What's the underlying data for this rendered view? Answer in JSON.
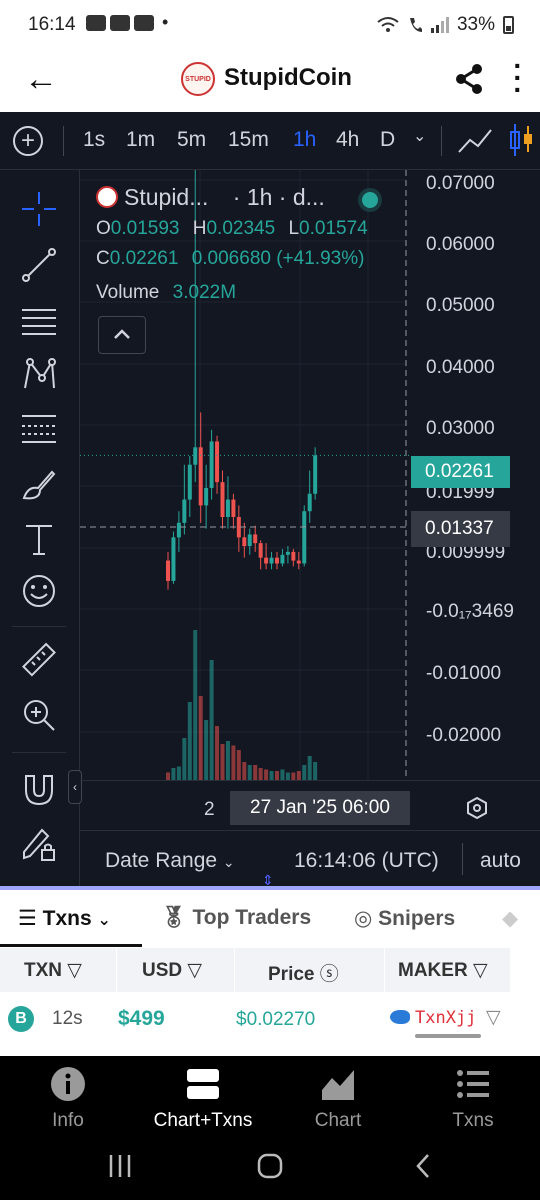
{
  "status_bar": {
    "time": "16:14",
    "dot": "•",
    "battery": "33%"
  },
  "header": {
    "title": "StupidCoin",
    "logo_text": "STUPID"
  },
  "toolbar": {
    "timeframes": [
      "1s",
      "1m",
      "5m",
      "15m",
      "1h",
      "4h",
      "D"
    ],
    "active_timeframe": "1h"
  },
  "legend": {
    "symbol": "Stupid...",
    "interval": "· 1h · d...",
    "o_label": "O",
    "o_value": "0.01593",
    "h_label": "H",
    "h_value": "0.02345",
    "l_label": "L",
    "l_value": "0.01574",
    "c_label": "C",
    "c_value": "0.02261",
    "change": "0.006680 (+41.93%)",
    "volume_label": "Volume",
    "volume_value": "3.022M"
  },
  "price_axis": {
    "labels": [
      "0.07000",
      "0.06000",
      "0.05000",
      "0.04000",
      "0.03000",
      "0.01999",
      "0.009999",
      "-0.0₁₇3469",
      "-0.01000",
      "-0.02000"
    ],
    "last_price": "0.02261",
    "crosshair_price": "0.01337"
  },
  "time_axis": {
    "tick": "2",
    "crosshair_time": "27 Jan '25   06:00"
  },
  "range_bar": {
    "date_range": "Date Range",
    "clock": "16:14:06 (UTC)",
    "auto": "auto"
  },
  "colors": {
    "up": "#26a69a",
    "down": "#ef5350",
    "accent": "#2962ff",
    "background": "#131722"
  },
  "chart_data": {
    "type": "candlestick",
    "x_label_visible": "27 Jan '25 06:00",
    "ylim": [
      -0.025,
      0.07
    ],
    "candles": [
      {
        "o": 0.0045,
        "h": 0.006,
        "l": -0.0005,
        "c": 0.001
      },
      {
        "o": 0.001,
        "h": 0.0095,
        "l": 0.0005,
        "c": 0.0085
      },
      {
        "o": 0.0085,
        "h": 0.013,
        "l": 0.006,
        "c": 0.011
      },
      {
        "o": 0.011,
        "h": 0.021,
        "l": 0.009,
        "c": 0.015
      },
      {
        "o": 0.015,
        "h": 0.0225,
        "l": 0.012,
        "c": 0.021
      },
      {
        "o": 0.021,
        "h": 0.072,
        "l": 0.018,
        "c": 0.024
      },
      {
        "o": 0.024,
        "h": 0.03,
        "l": 0.011,
        "c": 0.014
      },
      {
        "o": 0.014,
        "h": 0.021,
        "l": 0.01,
        "c": 0.017
      },
      {
        "o": 0.017,
        "h": 0.027,
        "l": 0.015,
        "c": 0.025
      },
      {
        "o": 0.025,
        "h": 0.026,
        "l": 0.016,
        "c": 0.018
      },
      {
        "o": 0.018,
        "h": 0.02,
        "l": 0.01,
        "c": 0.012
      },
      {
        "o": 0.012,
        "h": 0.019,
        "l": 0.01,
        "c": 0.015
      },
      {
        "o": 0.015,
        "h": 0.016,
        "l": 0.01,
        "c": 0.012
      },
      {
        "o": 0.012,
        "h": 0.014,
        "l": 0.006,
        "c": 0.0085
      },
      {
        "o": 0.0085,
        "h": 0.011,
        "l": 0.005,
        "c": 0.007
      },
      {
        "o": 0.007,
        "h": 0.01,
        "l": 0.0055,
        "c": 0.009
      },
      {
        "o": 0.009,
        "h": 0.0105,
        "l": 0.006,
        "c": 0.0075
      },
      {
        "o": 0.0075,
        "h": 0.008,
        "l": 0.003,
        "c": 0.005
      },
      {
        "o": 0.005,
        "h": 0.0075,
        "l": 0.003,
        "c": 0.004
      },
      {
        "o": 0.004,
        "h": 0.006,
        "l": 0.003,
        "c": 0.005
      },
      {
        "o": 0.005,
        "h": 0.006,
        "l": 0.003,
        "c": 0.004
      },
      {
        "o": 0.004,
        "h": 0.0065,
        "l": 0.0035,
        "c": 0.0055
      },
      {
        "o": 0.0055,
        "h": 0.007,
        "l": 0.004,
        "c": 0.006
      },
      {
        "o": 0.006,
        "h": 0.0065,
        "l": 0.0035,
        "c": 0.0045
      },
      {
        "o": 0.0045,
        "h": 0.006,
        "l": 0.003,
        "c": 0.004
      },
      {
        "o": 0.004,
        "h": 0.014,
        "l": 0.0035,
        "c": 0.013
      },
      {
        "o": 0.013,
        "h": 0.02,
        "l": 0.011,
        "c": 0.016
      },
      {
        "o": 0.016,
        "h": 0.024,
        "l": 0.015,
        "c": 0.0226
      }
    ],
    "volumes": [
      0.05,
      0.08,
      0.09,
      0.28,
      0.52,
      1.0,
      0.56,
      0.4,
      0.8,
      0.36,
      0.24,
      0.26,
      0.23,
      0.2,
      0.12,
      0.1,
      0.1,
      0.08,
      0.07,
      0.06,
      0.06,
      0.07,
      0.05,
      0.05,
      0.06,
      0.1,
      0.16,
      0.12
    ]
  },
  "panel": {
    "tabs": [
      "Txns",
      "Top Traders",
      "Snipers"
    ],
    "active_tab": "Txns",
    "columns": [
      "TXN",
      "USD",
      "Price",
      "MAKER"
    ],
    "rows": [
      {
        "type": "B",
        "age": "12s",
        "usd": "$499",
        "price": "$0.02270",
        "maker": "TxnXjj"
      }
    ]
  },
  "bottom_nav": {
    "items": [
      "Info",
      "Chart+Txns",
      "Chart",
      "Txns"
    ],
    "active": "Chart+Txns"
  }
}
